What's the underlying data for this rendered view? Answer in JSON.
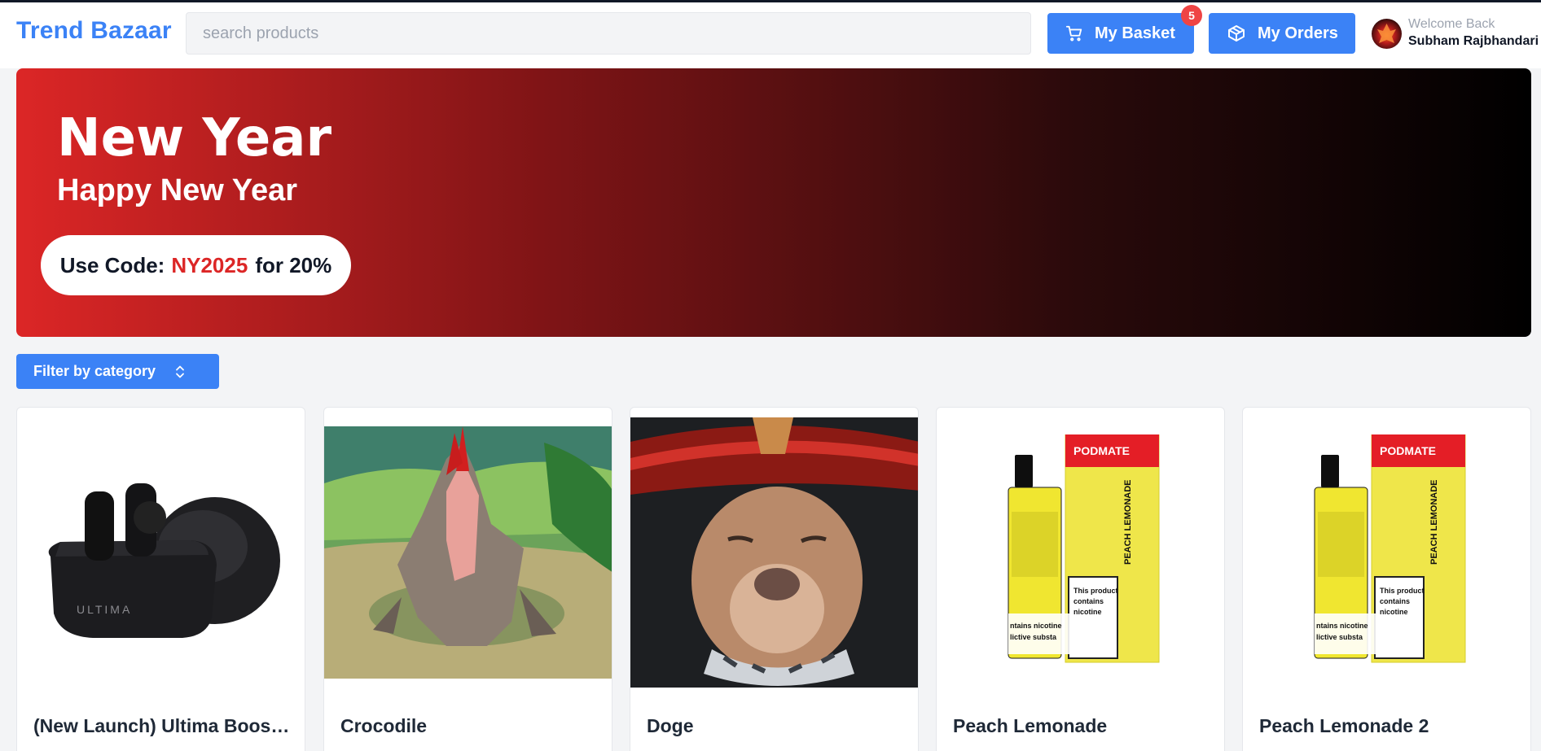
{
  "header": {
    "logo": "Trend Bazaar",
    "search_placeholder": "search products",
    "basket_label": "My Basket",
    "basket_count": "5",
    "orders_label": "My Orders",
    "welcome_text": "Welcome Back",
    "user_name": "Subham Rajbhandari"
  },
  "banner": {
    "title": "New Year",
    "subtitle": "Happy New Year",
    "promo_prefix": "Use Code:",
    "promo_code": "NY2025",
    "promo_suffix": "for 20%"
  },
  "filter": {
    "label": "Filter by category"
  },
  "products": [
    {
      "name": "(New Launch) Ultima Boost Pods",
      "image": "earbuds-case"
    },
    {
      "name": "Crocodile",
      "image": "crocodile-creature"
    },
    {
      "name": "Doge",
      "image": "dog-with-hat"
    },
    {
      "name": "Peach Lemonade",
      "image": "e-liquid-bottle-box"
    },
    {
      "name": "Peach Lemonade 2",
      "image": "e-liquid-bottle-box"
    }
  ],
  "colors": {
    "accent": "#3b82f6",
    "badge": "#ef4444",
    "promo_code": "#dc2626",
    "banner_start": "#dc2626",
    "banner_end": "#000000"
  }
}
